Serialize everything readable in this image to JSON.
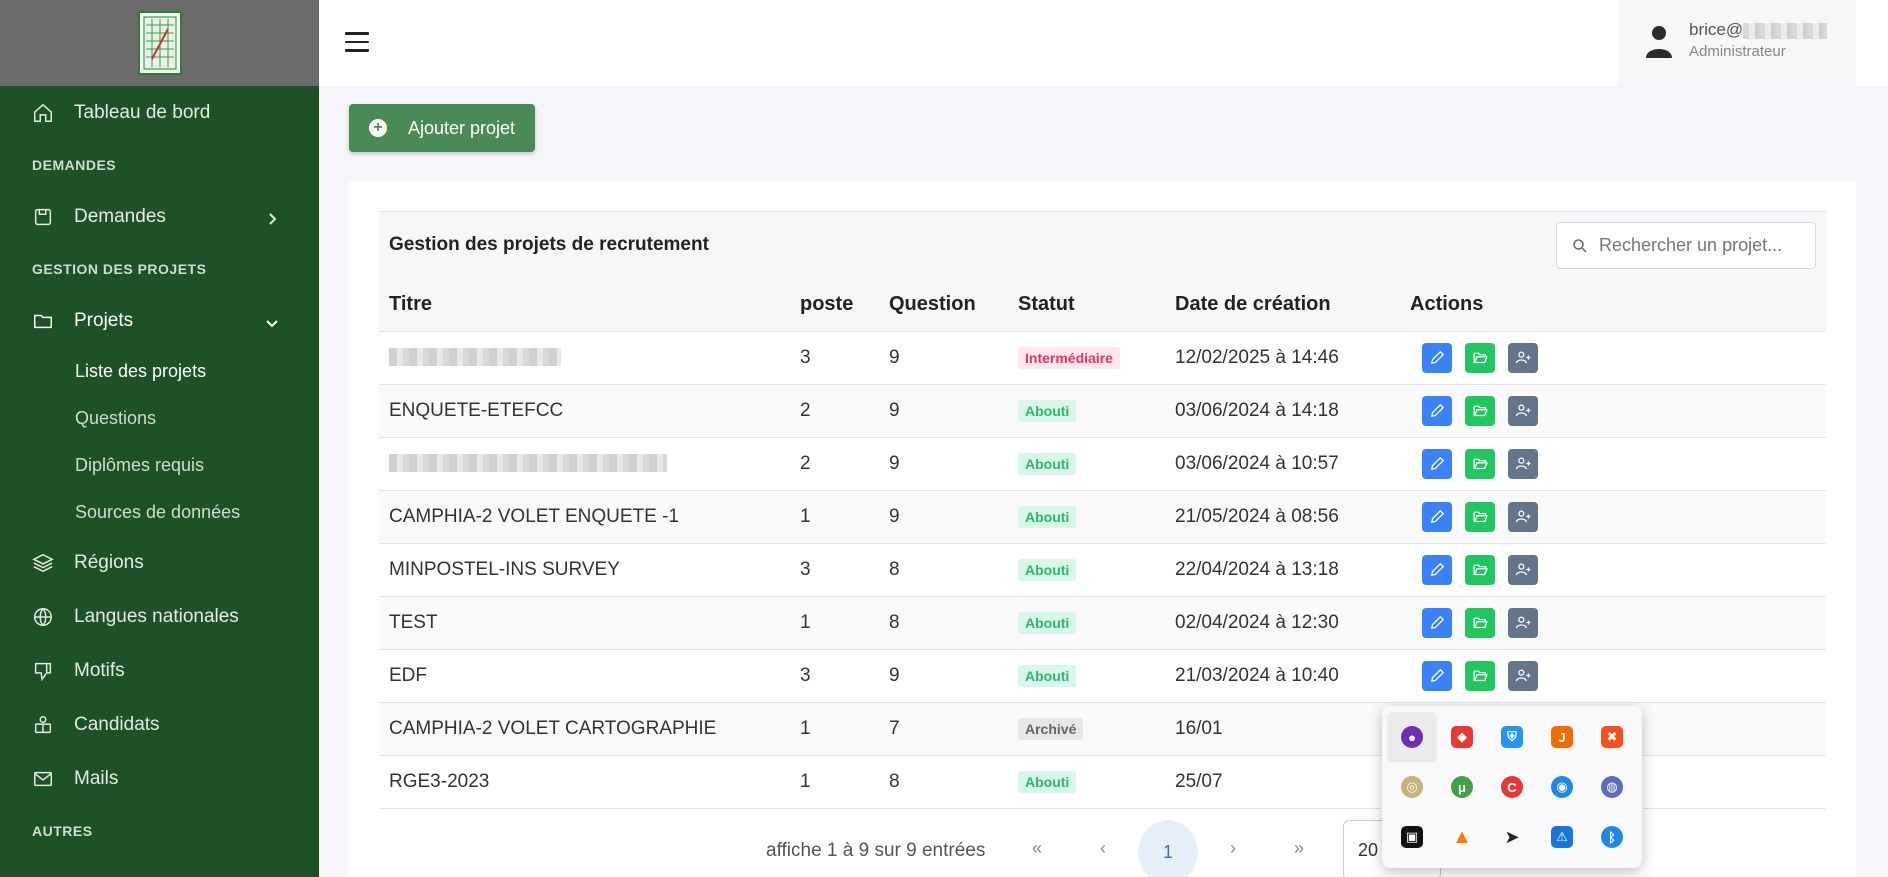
{
  "sidebar": {
    "items": {
      "dashboard": "Tableau de bord",
      "section_demandes": "DEMANDES",
      "demandes": "Demandes",
      "section_projets": "GESTION DES PROJETS",
      "projets": "Projets",
      "sub_liste": "Liste des projets",
      "sub_questions": "Questions",
      "sub_diplomes": "Diplômes requis",
      "sub_sources": "Sources de données",
      "regions": "Régions",
      "langues": "Langues nationales",
      "motifs": "Motifs",
      "candidats": "Candidats",
      "mails": "Mails",
      "section_autres": "AUTRES"
    }
  },
  "user": {
    "name": "brice@",
    "role": "Administrateur"
  },
  "toolbar": {
    "add_label": "Ajouter projet"
  },
  "card": {
    "title": "Gestion des projets de recrutement",
    "search_placeholder": "Rechercher un projet..."
  },
  "table": {
    "headers": [
      "Titre",
      "poste",
      "Question",
      "Statut",
      "Date de création",
      "Actions"
    ],
    "rows": [
      {
        "titre": "",
        "poste": "3",
        "question": "9",
        "statut": "Intermédiaire",
        "date": "12/02/2025 à 14:46"
      },
      {
        "titre": "ENQUETE-ETEFCC",
        "poste": "2",
        "question": "9",
        "statut": "Abouti",
        "date": "03/06/2024 à 14:18"
      },
      {
        "titre": "",
        "poste": "2",
        "question": "9",
        "statut": "Abouti",
        "date": "03/06/2024 à 10:57"
      },
      {
        "titre": "CAMPHIA-2 VOLET ENQUETE -1",
        "poste": "1",
        "question": "9",
        "statut": "Abouti",
        "date": "21/05/2024 à 08:56"
      },
      {
        "titre": "MINPOSTEL-INS SURVEY",
        "poste": "3",
        "question": "8",
        "statut": "Abouti",
        "date": "22/04/2024 à 13:18"
      },
      {
        "titre": "TEST",
        "poste": "1",
        "question": "8",
        "statut": "Abouti",
        "date": "02/04/2024 à 12:30"
      },
      {
        "titre": "EDF",
        "poste": "3",
        "question": "9",
        "statut": "Abouti",
        "date": "21/03/2024 à 10:40"
      },
      {
        "titre": "CAMPHIA-2 VOLET CARTOGRAPHIE",
        "poste": "1",
        "question": "7",
        "statut": "Archivé",
        "date": "16/01"
      },
      {
        "titre": "RGE3-2023",
        "poste": "1",
        "question": "8",
        "statut": "Abouti",
        "date": "25/07"
      }
    ]
  },
  "pagination": {
    "info": "affiche 1 à 9 sur 9 entrées",
    "first": "«",
    "prev": "‹",
    "current": "1",
    "next": "›",
    "last": "»",
    "page_size": "20"
  },
  "colors": {
    "sidebar": "#1e5128",
    "accent": "#4a8a57"
  }
}
